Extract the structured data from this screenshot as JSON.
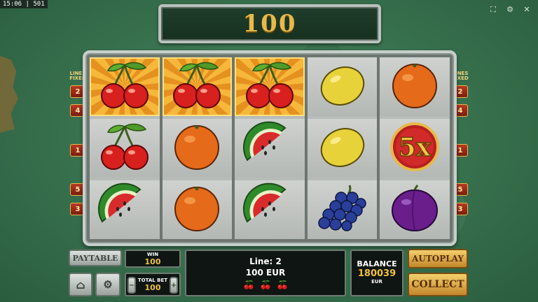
{
  "status_bar": {
    "time": "15:06",
    "separator": "|",
    "id": "501"
  },
  "top_icons": [
    "fullscreen-icon",
    "settings-icon",
    "close-icon"
  ],
  "win_display": {
    "value": "100"
  },
  "reels": [
    [
      "cherries",
      "cherries",
      "watermelon"
    ],
    [
      "cherries",
      "orange",
      "orange"
    ],
    [
      "cherries",
      "watermelon",
      "watermelon"
    ],
    [
      "lemon",
      "lemon",
      "grapes"
    ],
    [
      "orange",
      "5x",
      "plum"
    ]
  ],
  "winning_row": 0,
  "lines_left": {
    "title": "LINES",
    "subtitle": "FIXED",
    "badges": [
      "2",
      "4",
      "1",
      "5",
      "3"
    ]
  },
  "lines_right": {
    "title": "LINES",
    "subtitle": "FIXED",
    "badges": [
      "2",
      "4",
      "1",
      "5",
      "3"
    ]
  },
  "paytable": {
    "label": "PAYTABLE"
  },
  "win_box": {
    "label": "WIN",
    "value": "100"
  },
  "total_bet": {
    "label": "TOTAL BET",
    "value": "100",
    "minus": "−",
    "plus": "+"
  },
  "line_info": {
    "line": "Line: 2",
    "amount": "100 EUR",
    "symbol_count": 3
  },
  "balance": {
    "label": "BALANCE",
    "value": "180039",
    "currency": "EUR"
  },
  "autoplay": {
    "label": "AUTOPLAY"
  },
  "collect": {
    "label": "COLLECT"
  },
  "colors": {
    "accent_gold": "#e6b94a",
    "win_glow": "#f6b73a",
    "badge_red": "#b73a23"
  }
}
